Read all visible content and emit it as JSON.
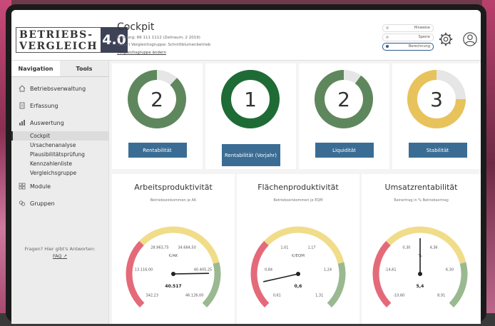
{
  "app": {
    "logo_line1": "BETRIEBS-",
    "logo_line2": "VERGLEICH",
    "logo_version": "4.0",
    "page_title": "Cockpit",
    "meta_line1": "Kennung: 66 111 1112 (Zeitraum: 2 2019)",
    "meta_line2": "(1112) Vergleichsgruppe: Schnittblumenbetrieb",
    "meta_link": "Vergleichsgruppe ändern",
    "filters": [
      {
        "label": "Hinweise",
        "active": false
      },
      {
        "label": "Sperre",
        "active": false
      },
      {
        "label": "Berechnung",
        "active": true
      }
    ]
  },
  "sidebar": {
    "tabs": [
      "Navigation",
      "Tools"
    ],
    "items": [
      {
        "label": "Betriebsverwaltung",
        "icon": "home-icon"
      },
      {
        "label": "Erfassung",
        "icon": "document-icon"
      },
      {
        "label": "Auswertung",
        "icon": "chart-icon"
      }
    ],
    "sub_items": [
      "Cockpit",
      "Ursachenanalyse",
      "Plausibilitätsprüfung",
      "Kennzahlenliste",
      "Vergleichsgruppe"
    ],
    "active_sub": "Cockpit",
    "extra_items": [
      {
        "label": "Module",
        "icon": "grid-icon"
      },
      {
        "label": "Gruppen",
        "icon": "group-icon"
      }
    ],
    "help_text": "Fragen? Hier gibt's Antworten:",
    "help_link": "FAQ"
  },
  "cards": [
    {
      "value": "2",
      "label": "Rentabilität",
      "fill": 0.88,
      "color": "#7a9e78",
      "ring": "#5f875d"
    },
    {
      "value": "1",
      "label": "Rentabilität (Vorjahr)",
      "fill": 1.0,
      "color": "#1f6b35",
      "ring": "#1f6b35"
    },
    {
      "value": "2",
      "label": "Liquidität",
      "fill": 0.9,
      "color": "#7a9e78",
      "ring": "#5f875d"
    },
    {
      "value": "3",
      "label": "Stabilität",
      "fill": 0.75,
      "color": "#e8c35c",
      "ring": "#e8c35c"
    }
  ],
  "gauges": [
    {
      "title": "Arbeitsproduktivität",
      "subtitle": "Betriebseinkommen je AK",
      "unit": "€/AK",
      "ticks": [
        "0",
        "13.116,00",
        "28.963,75",
        "34.684,50",
        "40.405,25",
        "46.126,00",
        "342,23"
      ],
      "tick_labels_shown": [
        "342,23",
        "13.116,00",
        "28.963,75",
        "34.684,50",
        "40.405,25",
        "46.126,00"
      ],
      "value": "40.517",
      "needle": 0.83
    },
    {
      "title": "Flächenproduktivität",
      "subtitle": "Betriebseinkommen je EQM",
      "unit": "€/EQM",
      "tick_labels_shown": [
        "0,61",
        "0,84",
        "1,01",
        "1,17",
        "1,24",
        "1,31"
      ],
      "value": "0,6",
      "needle": 0.12
    },
    {
      "title": "Umsatzrentabilität",
      "subtitle": "Reinertrag in % Betriebsertrag",
      "unit": "%",
      "tick_labels_shown": [
        "-10,60",
        "-14,61",
        "0,30",
        "4,36",
        "6,30",
        "8,91"
      ],
      "value": "5,4",
      "needle": 0.5
    }
  ]
}
